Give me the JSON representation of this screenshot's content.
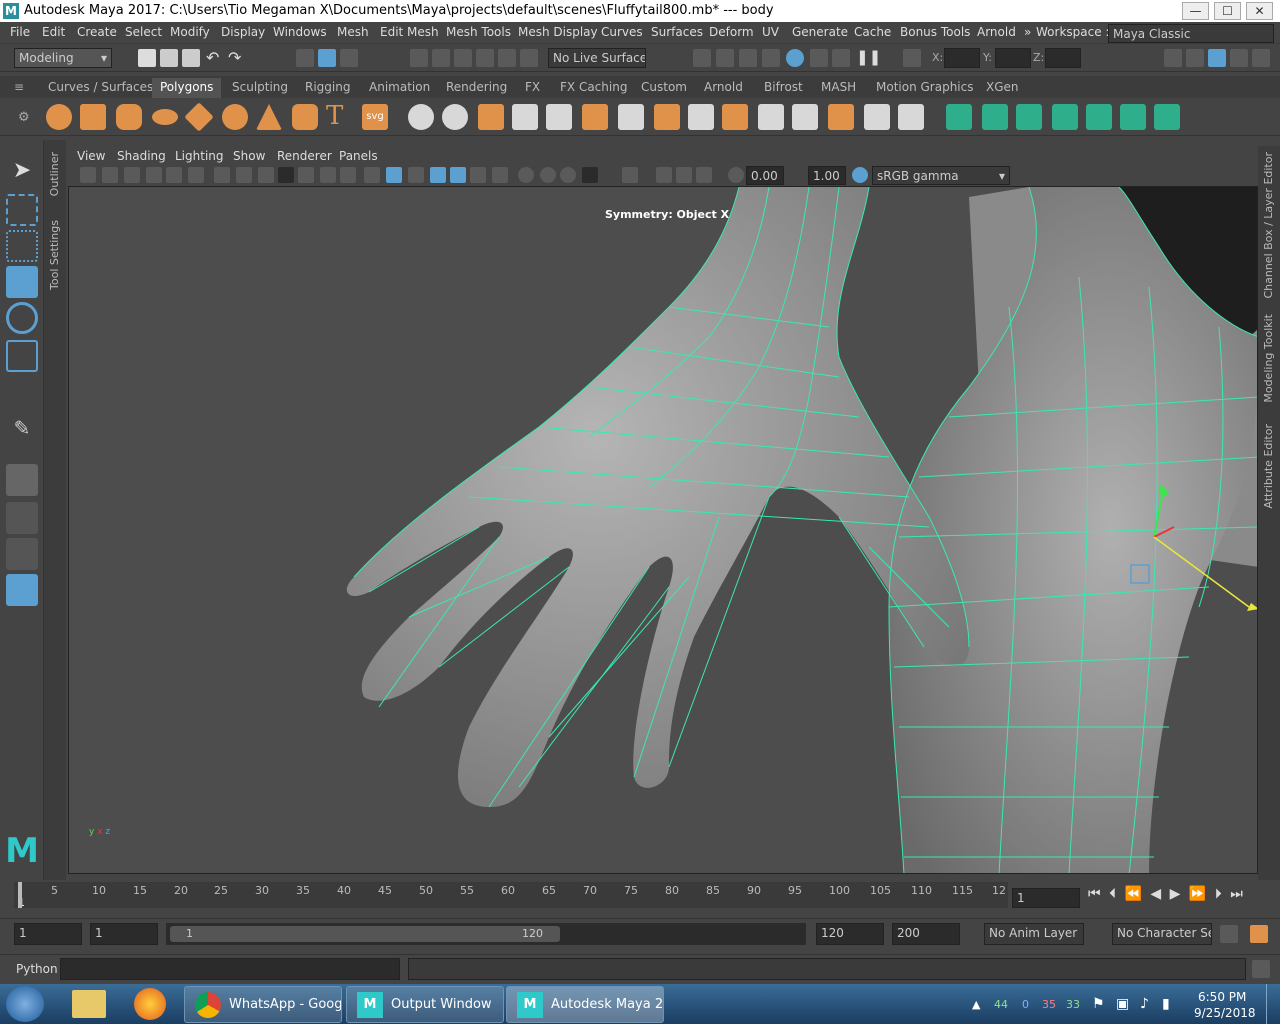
{
  "window": {
    "title": "Autodesk Maya 2017: C:\\Users\\Tio Megaman X\\Documents\\Maya\\projects\\default\\scenes\\Fluffytail800.mb*   ---   body",
    "logo": "M",
    "min": "—",
    "max": "☐",
    "close": "✕"
  },
  "menus": [
    "File",
    "Edit",
    "Create",
    "Select",
    "Modify",
    "Display",
    "Windows",
    "Mesh",
    "Edit Mesh",
    "Mesh Tools",
    "Mesh Display",
    "Curves",
    "Surfaces",
    "Deform",
    "UV",
    "Generate",
    "Cache",
    "Bonus Tools",
    "Arnold"
  ],
  "workspace": {
    "label": "Workspace :",
    "value": "Maya Classic",
    "arrows": "»"
  },
  "status": {
    "menuset": "Modeling",
    "live_surface": "No Live Surface",
    "x_label": "X:",
    "y_label": "Y:",
    "z_label": "Z:"
  },
  "shelf_tabs": [
    "Curves / Surfaces",
    "Polygons",
    "Sculpting",
    "Rigging",
    "Animation",
    "Rendering",
    "FX",
    "FX Caching",
    "Custom",
    "Arnold",
    "Bifrost",
    "MASH",
    "Motion Graphics",
    "XGen"
  ],
  "shelf_active": "Polygons",
  "shelf_text_icons": {
    "text": "T",
    "svg": "svg"
  },
  "left_tabs": {
    "outliner": "Outliner",
    "tool_settings": "Tool Settings"
  },
  "right_tabs": {
    "channel_box": "Channel Box / Layer Editor",
    "modeling_toolkit": "Modeling Toolkit",
    "attribute_editor": "Attribute Editor"
  },
  "panel_menu": [
    "View",
    "Shading",
    "Lighting",
    "Show",
    "Renderer",
    "Panels"
  ],
  "panel_tools": {
    "exposure": "0.00",
    "gamma": "1.00",
    "colorspace": "sRGB gamma"
  },
  "viewport": {
    "symmetry": "Symmetry: Object X",
    "axis_x": "x",
    "axis_y": "y",
    "axis_z": "z"
  },
  "timeline": {
    "ticks": [
      "1",
      "5",
      "10",
      "15",
      "20",
      "25",
      "30",
      "35",
      "40",
      "45",
      "50",
      "55",
      "60",
      "65",
      "70",
      "75",
      "80",
      "85",
      "90",
      "95",
      "100",
      "105",
      "110",
      "115",
      "12"
    ],
    "current_frame": "1"
  },
  "range": {
    "start": "1",
    "playback_start": "1",
    "slider_start": "1",
    "slider_end": "120",
    "playback_end": "120",
    "end": "200",
    "anim_layer": "No Anim Layer",
    "char_set": "No Character Set"
  },
  "command": {
    "language": "Python"
  },
  "taskbar": {
    "apps": [
      "WhatsApp - Goog...",
      "Output Window",
      "Autodesk Maya 2..."
    ],
    "tray_nums": [
      "44",
      "0",
      "35",
      "33"
    ],
    "time": "6:50 PM",
    "date": "9/25/2018"
  },
  "colors": {
    "wire": "#3be7b4",
    "accent": "#5c9fd1",
    "shelf_orange": "#e0924b",
    "shelf_green": "#2fae8c"
  }
}
